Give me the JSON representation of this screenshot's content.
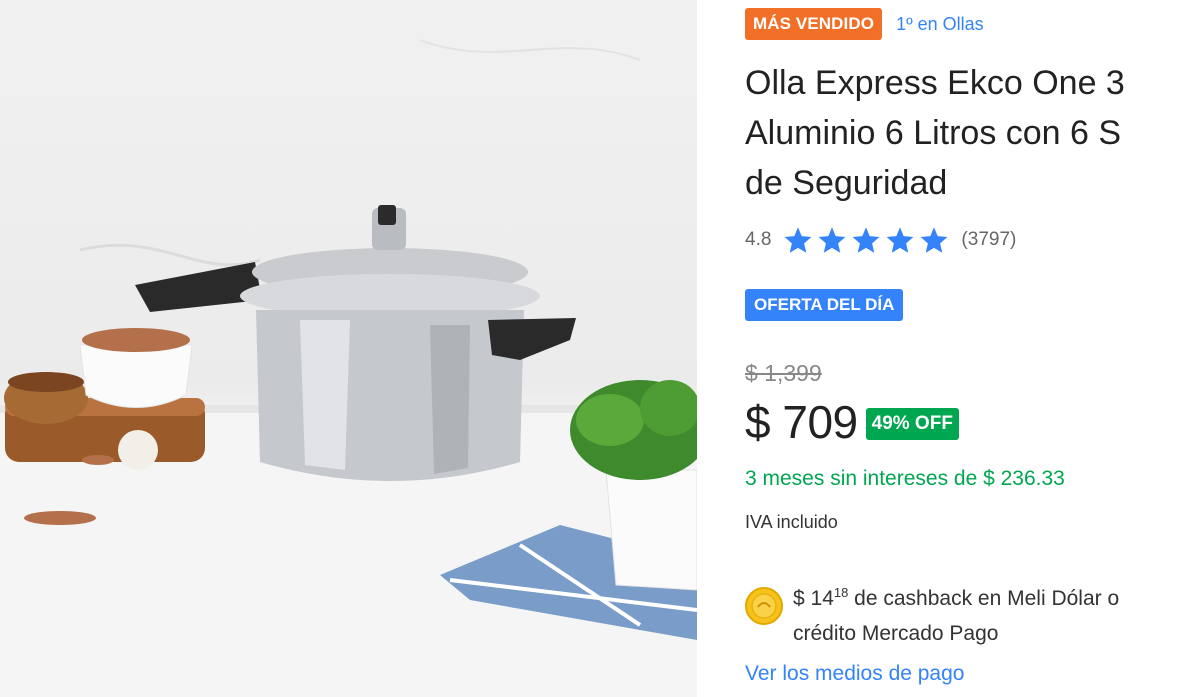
{
  "product": {
    "image_alt": "",
    "badge_best_seller": "MÁS VENDIDO",
    "rank_link": "1º en Ollas",
    "title_lines": [
      "Olla Express Ekco One 3",
      "Aluminio 6 Litros con 6 S",
      "de Seguridad"
    ],
    "rating": {
      "value": "4.8",
      "stars": 5,
      "count": "(3797)"
    },
    "deal_badge": "OFERTA DEL DÍA",
    "pricing": {
      "old_price": "$ 1,399",
      "price": "$ 709",
      "discount": "49% OFF",
      "installments": "3 meses sin intereses de $ 236.33",
      "tax_note": "IVA incluido"
    },
    "cashback": {
      "amount_main": "$ 14",
      "amount_cents": "18",
      "line1_rest": " de cashback en Meli Dólar o",
      "line2": "crédito Mercado Pago",
      "icon": "meli-dolar-coin-icon"
    },
    "payment_link": "Ver los medios de pago"
  },
  "colors": {
    "best_seller_orange": "#f26f27",
    "link_blue": "#3483fa",
    "green": "#00a650",
    "text_dark": "#222222"
  }
}
